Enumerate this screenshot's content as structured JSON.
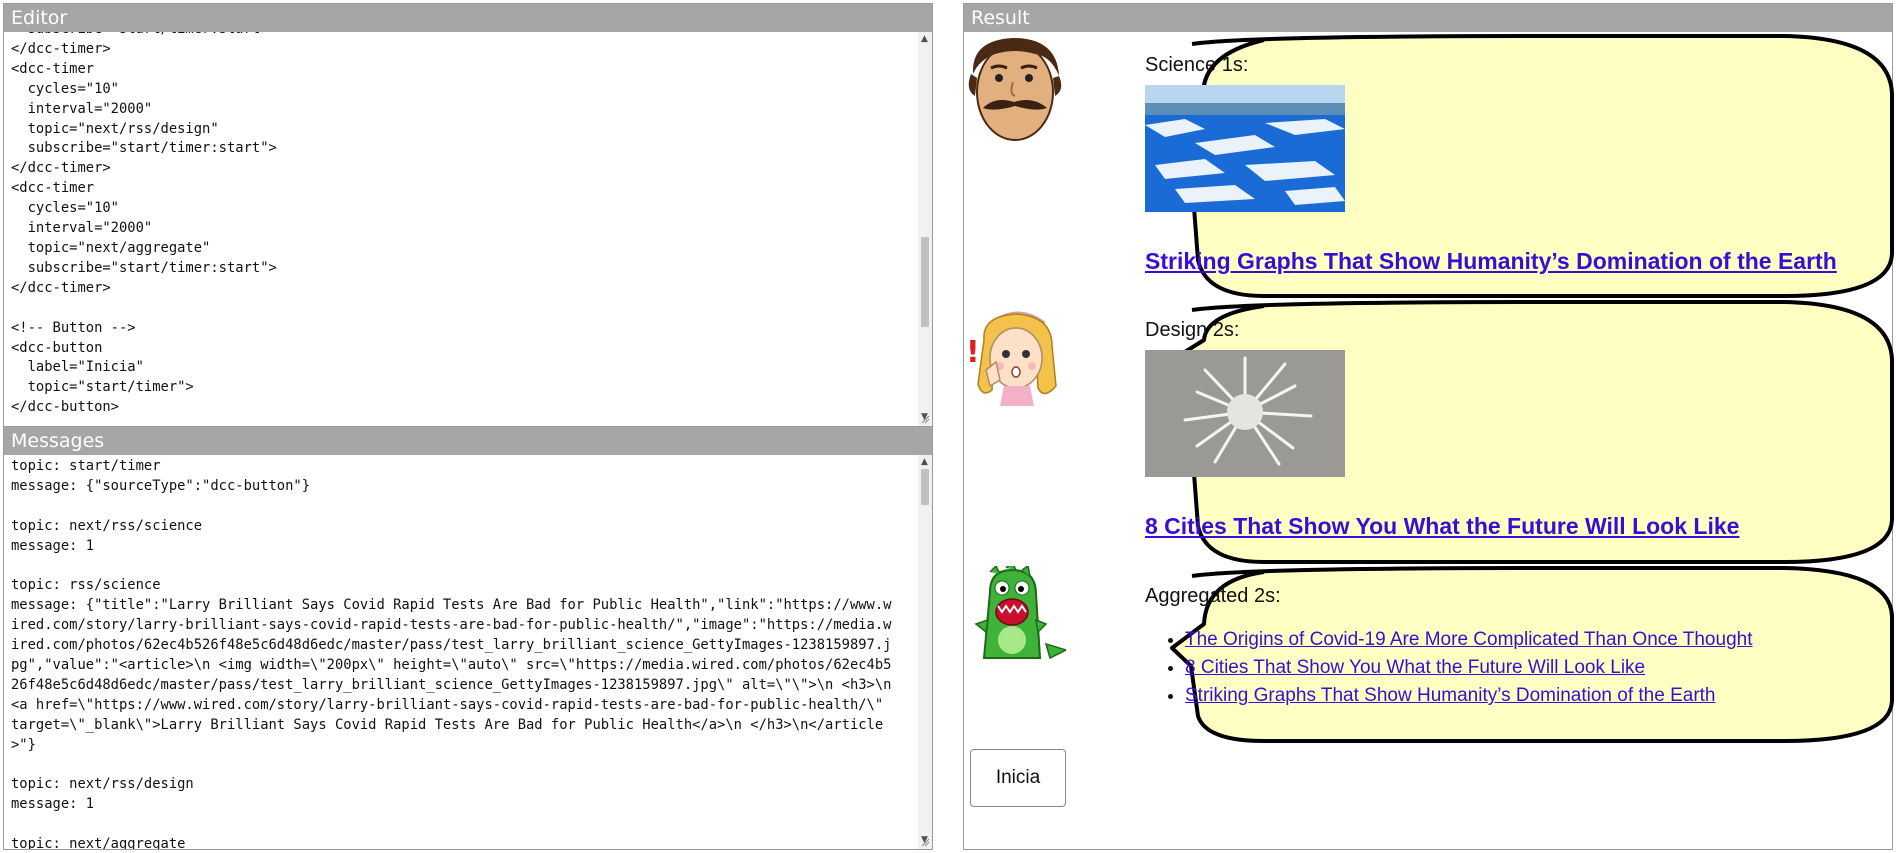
{
  "editor": {
    "title": "Editor",
    "lines": [
      "  subscribe=\"start/timer:start\">",
      "</dcc-timer>",
      "<dcc-timer",
      "  cycles=\"10\"",
      "  interval=\"2000\"",
      "  topic=\"next/rss/design\"",
      "  subscribe=\"start/timer:start\">",
      "</dcc-timer>",
      "<dcc-timer",
      "  cycles=\"10\"",
      "  interval=\"2000\"",
      "  topic=\"next/aggregate\"",
      "  subscribe=\"start/timer:start\">",
      "</dcc-timer>",
      "",
      "<!-- Button -->",
      "<dcc-button",
      "  label=\"Inicia\"",
      "  topic=\"start/timer\">",
      "</dcc-button>"
    ]
  },
  "messages": {
    "title": "Messages",
    "entries": [
      {
        "topic": "topic: start/timer",
        "message": "message: {\"sourceType\":\"dcc-button\"}"
      },
      {
        "topic": "topic: next/rss/science",
        "message": "message: 1"
      },
      {
        "topic": "topic: rss/science",
        "message": "message: {\"title\":\"Larry Brilliant Says Covid Rapid Tests Are Bad for Public Health\",\"link\":\"https://www.wired.com/story/larry-brilliant-says-covid-rapid-tests-are-bad-for-public-health/\",\"image\":\"https://media.wired.com/photos/62ec4b526f48e5c6d48d6edc/master/pass/test_larry_brilliant_science_GettyImages-1238159897.jpg\",\"value\":\"<article>\\n    <img width=\\\"200px\\\" height=\\\"auto\\\" src=\\\"https://media.wired.com/photos/62ec4b526f48e5c6d48d6edc/master/pass/test_larry_brilliant_science_GettyImages-1238159897.jpg\\\" alt=\\\"\\\">\\n   <h3>\\n      <a href=\\\"https://www.wired.com/story/larry-brilliant-says-covid-rapid-tests-are-bad-for-public-health/\\\" target=\\\"_blank\\\">Larry Brilliant Says Covid Rapid Tests Are Bad for Public Health</a>\\n   </h3>\\n</article>\"}"
      },
      {
        "topic": "topic: next/rss/design",
        "message": "message: 1"
      },
      {
        "topic": "topic: next/aggregate",
        "message": ""
      }
    ]
  },
  "result": {
    "title": "Result",
    "science": {
      "title": "Science 1s:",
      "headline": "Striking Graphs That Show Humanity’s Domination of the Earth"
    },
    "design": {
      "title": "Design 2s:",
      "headline": "8 Cities That Show You What the Future Will Look Like"
    },
    "aggregated": {
      "title": "Aggregated 2s:",
      "items": [
        "The Origins of Covid-19 Are More Complicated Than Once Thought",
        "8 Cities That Show You What the Future Will Look Like",
        "Striking Graphs That Show Humanity’s Domination of the Earth"
      ]
    },
    "button_label": "Inicia"
  },
  "colors": {
    "bubble_fill": "#ffffc4",
    "header_bg": "#a6a6a6",
    "link": "#3a0dd6"
  }
}
